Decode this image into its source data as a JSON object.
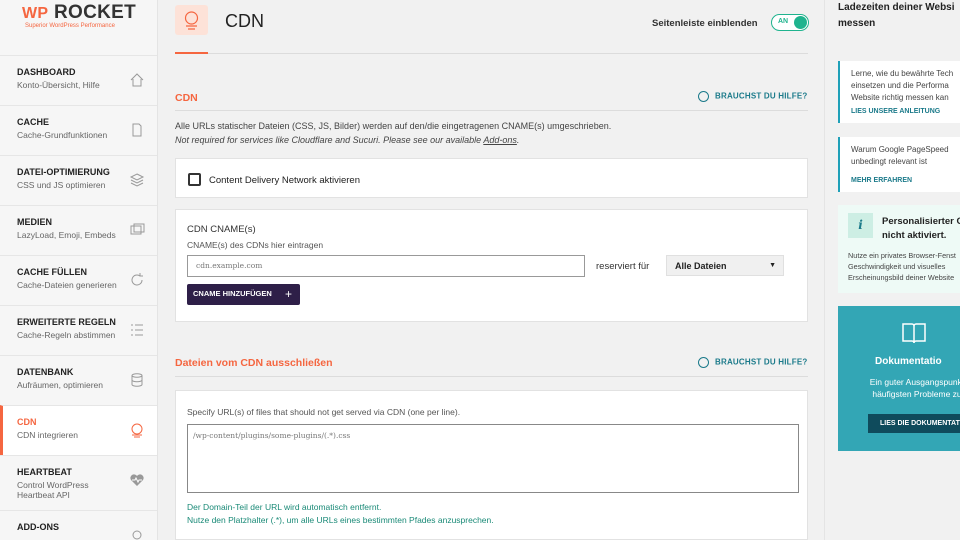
{
  "logo": {
    "brand_prefix": "WP",
    "brand_name": "ROCKET",
    "tagline": "Superior WordPress Performance"
  },
  "sidebar": {
    "items": [
      {
        "title": "DASHBOARD",
        "subtitle": "Konto-Übersicht, Hilfe",
        "icon": "home-icon"
      },
      {
        "title": "CACHE",
        "subtitle": "Cache-Grundfunktionen",
        "icon": "document-icon"
      },
      {
        "title": "DATEI-OPTIMIERUNG",
        "subtitle": "CSS und JS optimieren",
        "icon": "layers-icon"
      },
      {
        "title": "MEDIEN",
        "subtitle": "LazyLoad, Emoji, Embeds",
        "icon": "images-icon"
      },
      {
        "title": "CACHE FÜLLEN",
        "subtitle": "Cache-Dateien generieren",
        "icon": "refresh-icon"
      },
      {
        "title": "ERWEITERTE REGELN",
        "subtitle": "Cache-Regeln abstimmen",
        "icon": "list-icon"
      },
      {
        "title": "DATENBANK",
        "subtitle": "Aufräumen, optimieren",
        "icon": "database-icon"
      },
      {
        "title": "CDN",
        "subtitle": "CDN integrieren",
        "icon": "cdn-icon",
        "active": true
      },
      {
        "title": "HEARTBEAT",
        "subtitle": "Control WordPress Heartbeat API",
        "icon": "heartbeat-icon"
      },
      {
        "title": "ADD-ONS",
        "subtitle": "",
        "icon": "addons-icon"
      }
    ]
  },
  "header": {
    "title": "CDN",
    "sidebar_toggle_label": "Seitenleiste einblenden",
    "toggle_state": "AN"
  },
  "cdn_section": {
    "title": "CDN",
    "help": "BRAUCHST DU HILFE?",
    "description": "Alle URLs statischer Dateien (CSS, JS, Bilder) werden auf den/die eingetragenen CNAME(s) umgeschrieben.",
    "note_prefix": "Not required for services like Cloudflare and Sucuri. Please see our available ",
    "note_link": "Add-ons",
    "note_suffix": ".",
    "enable_label": "Content Delivery Network aktivieren",
    "cname_title": "CDN CNAME(s)",
    "cname_sublabel": "CNAME(s) des CDNs hier eintragen",
    "cname_placeholder": "cdn.example.com",
    "reserved_label": "reserviert für",
    "reserved_value": "Alle Dateien",
    "add_button": "CNAME HINZUFÜGEN",
    "add_icon": "+"
  },
  "exclude_section": {
    "title": "Dateien vom CDN ausschließen",
    "help": "BRAUCHST DU HILFE?",
    "label": "Specify URL(s) of files that should not get served via CDN (one per line).",
    "placeholder": "/wp-content/plugins/some-plugins/(.*).css",
    "hint1": "Der Domain-Teil der URL wird automatisch entfernt.",
    "hint2": "Nutze den Platzhalter (.*), um alle URLs eines bestimmten Pfades anzusprechen."
  },
  "right_panel": {
    "title": "Ladezeiten deiner Websi messen",
    "card1_text": "Lerne, wie du bewährte Tech einsetzen und die Performa Website richtig messen kan",
    "card1_link": "LIES UNSERE ANLEITUNG",
    "card2_text": "Warum Google PageSpeed unbedingt relevant ist",
    "card2_link": "MEHR ERFAHREN",
    "personal_icon": "i",
    "personal_title": "Personalisierter C nicht aktiviert.",
    "personal_text": "Nutze ein privates Browser-Fenst Geschwindigkeit und visuelles Erscheinungsbild deiner Website",
    "doc_title": "Dokumentatio",
    "doc_text": "Ein guter Ausgangspunkt häufigsten Probleme zu",
    "doc_button": "LIES DIE DOKUMENTAT"
  },
  "colors": {
    "accent": "#f56640",
    "teal": "#1b7a8a",
    "toggle": "#1fb38e",
    "button_dark": "#2e1f48",
    "doc_bg": "#33a6b5"
  }
}
